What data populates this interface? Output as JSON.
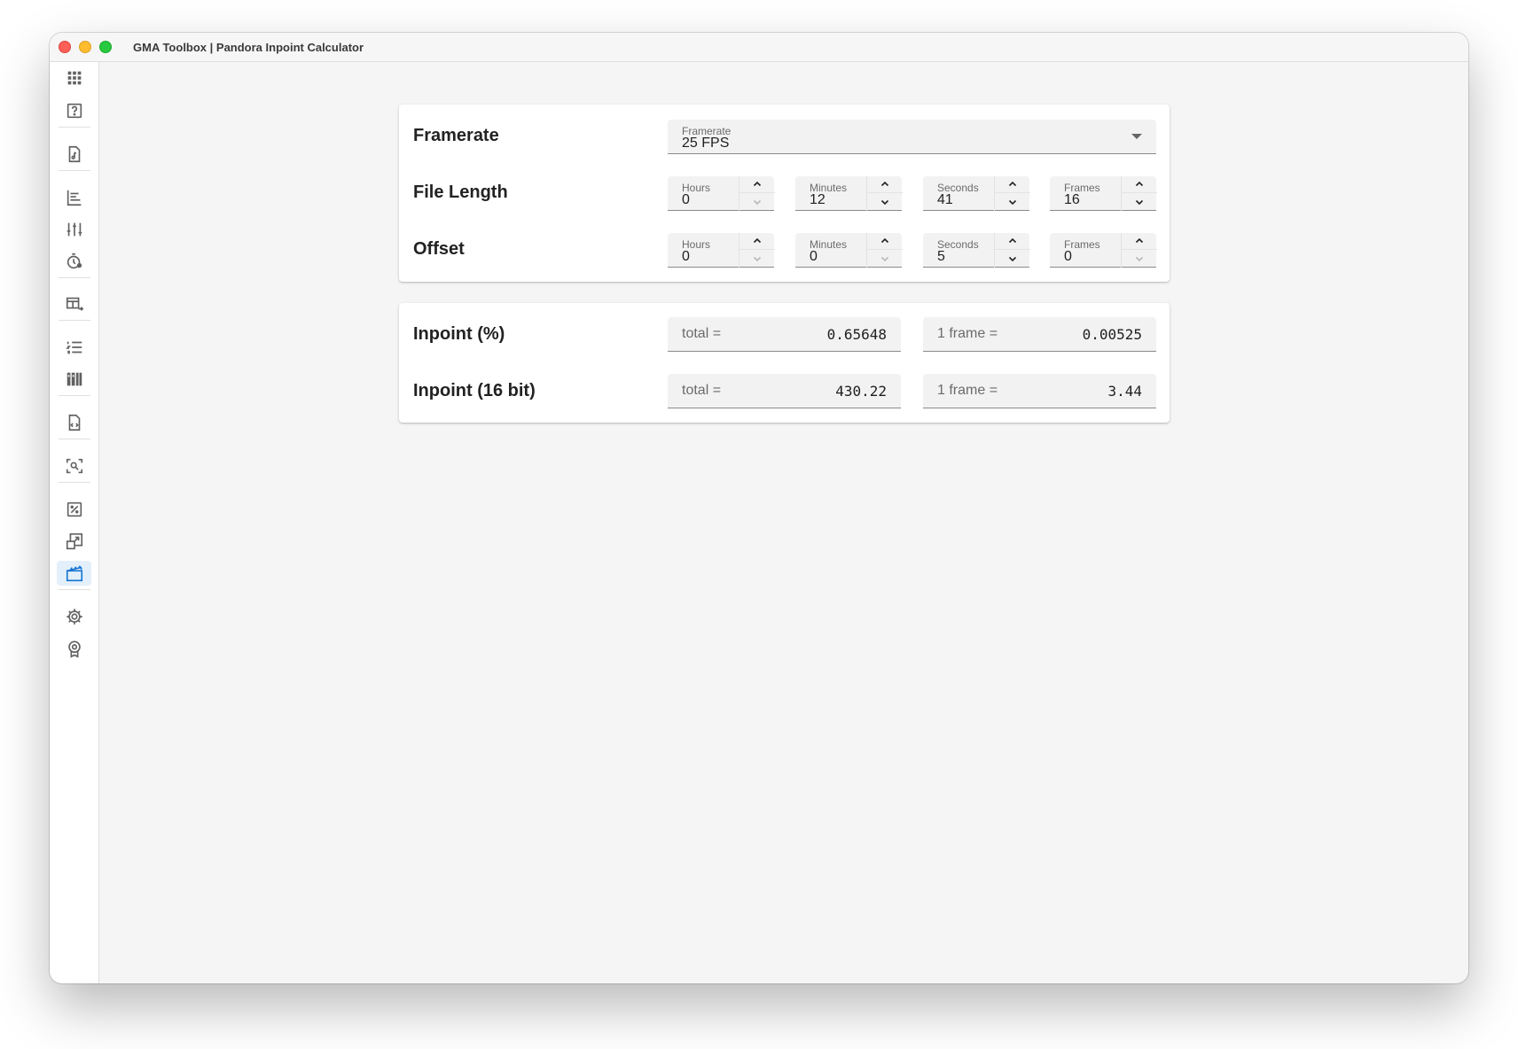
{
  "window": {
    "title": "GMA Toolbox | Pandora Inpoint Calculator"
  },
  "sidebar": {
    "items": [
      {
        "icon": "apps-grid-icon"
      },
      {
        "icon": "help-box-icon"
      },
      {
        "icon": "music-file-icon"
      },
      {
        "icon": "align-left-bars-icon"
      },
      {
        "icon": "sliders-icon"
      },
      {
        "icon": "timer-icon"
      },
      {
        "icon": "table-arrow-icon"
      },
      {
        "icon": "numbered-list-icon"
      },
      {
        "icon": "library-books-icon"
      },
      {
        "icon": "file-code-icon"
      },
      {
        "icon": "image-search-icon"
      },
      {
        "icon": "percent-box-icon"
      },
      {
        "icon": "resize-icon"
      },
      {
        "icon": "clapperboard-icon",
        "active": true
      },
      {
        "icon": "gear-icon"
      },
      {
        "icon": "badge-icon"
      }
    ],
    "active_color": "#1976d2"
  },
  "settings": {
    "framerate": {
      "row_label": "Framerate",
      "field_label": "Framerate",
      "value": "25 FPS"
    },
    "file_length": {
      "row_label": "File Length",
      "hours": {
        "label": "Hours",
        "value": "0"
      },
      "minutes": {
        "label": "Minutes",
        "value": "12"
      },
      "seconds": {
        "label": "Seconds",
        "value": "41"
      },
      "frames": {
        "label": "Frames",
        "value": "16"
      }
    },
    "offset": {
      "row_label": "Offset",
      "hours": {
        "label": "Hours",
        "value": "0"
      },
      "minutes": {
        "label": "Minutes",
        "value": "0"
      },
      "seconds": {
        "label": "Seconds",
        "value": "5"
      },
      "frames": {
        "label": "Frames",
        "value": "0"
      }
    }
  },
  "results": {
    "percent": {
      "row_label": "Inpoint (%)",
      "total_prefix": "total =",
      "total_value": "0.65648",
      "frame_prefix": "1 frame =",
      "frame_value": "0.00525"
    },
    "bit16": {
      "row_label": "Inpoint (16 bit)",
      "total_prefix": "total =",
      "total_value": "430.22",
      "frame_prefix": "1 frame =",
      "frame_value": "3.44"
    }
  }
}
